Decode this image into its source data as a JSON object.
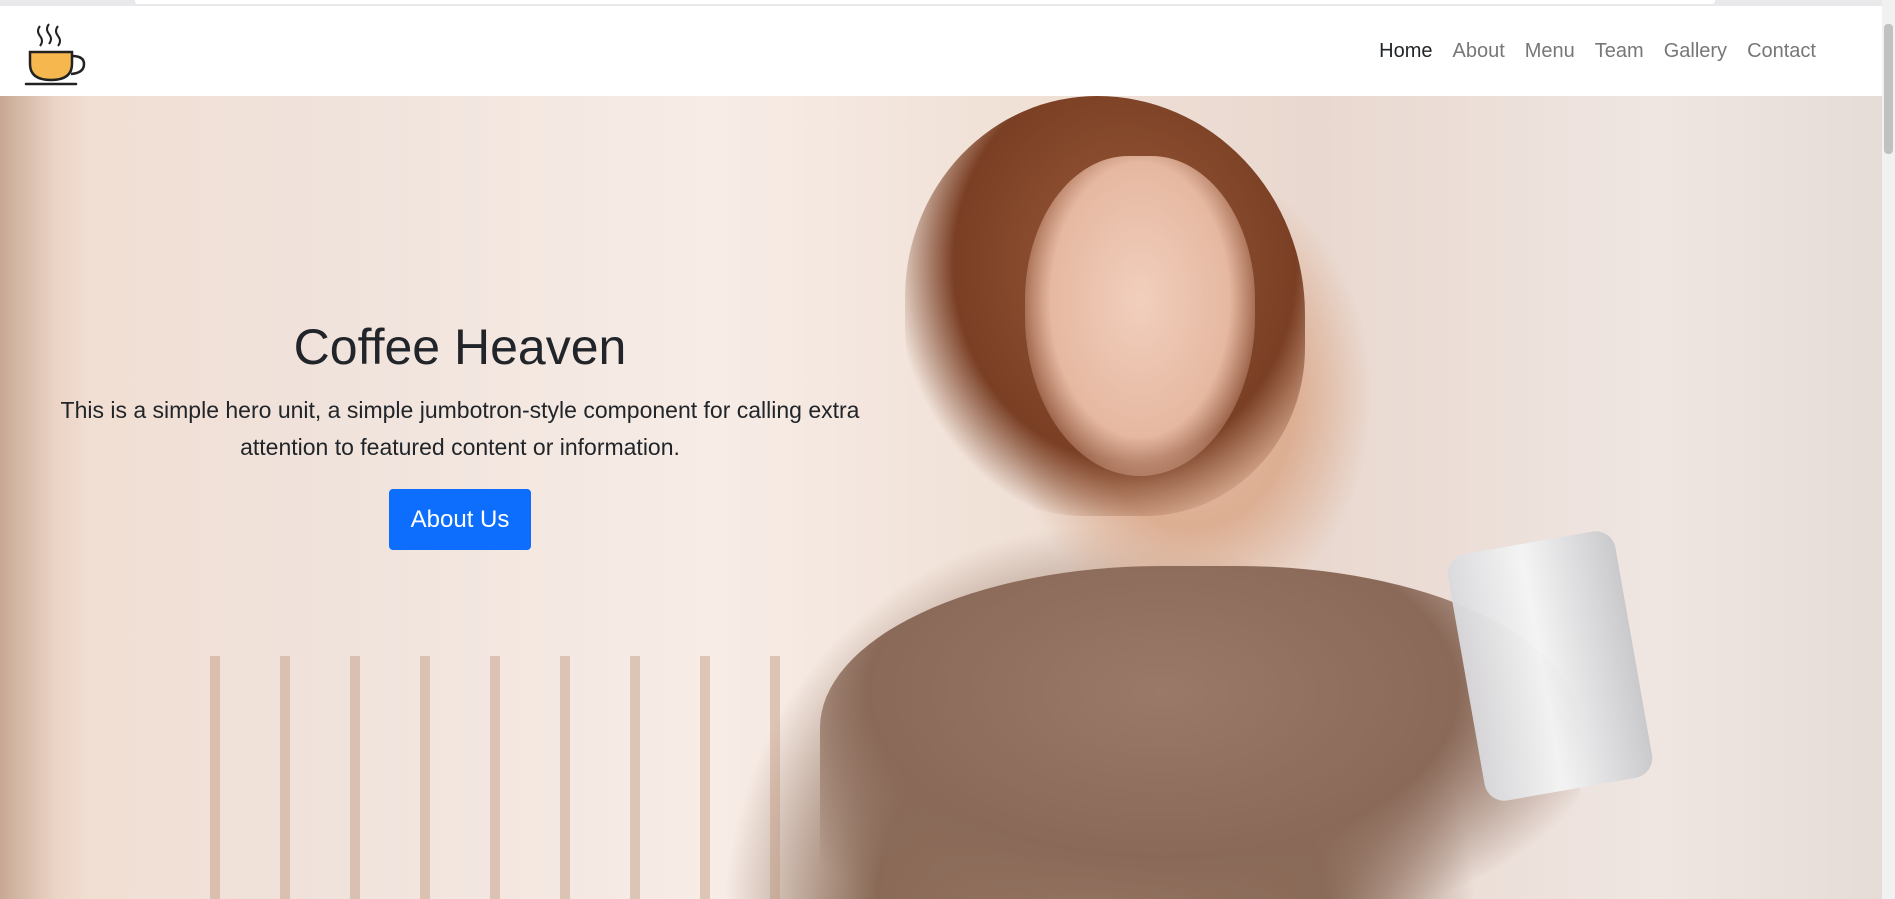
{
  "site": {
    "logo_icon": "coffee-cup-icon"
  },
  "nav": {
    "items": [
      {
        "label": "Home",
        "active": true
      },
      {
        "label": "About",
        "active": false
      },
      {
        "label": "Menu",
        "active": false
      },
      {
        "label": "Team",
        "active": false
      },
      {
        "label": "Gallery",
        "active": false
      },
      {
        "label": "Contact",
        "active": false
      }
    ]
  },
  "hero": {
    "title": "Coffee Heaven",
    "text": "This is a simple hero unit, a simple jumbotron-style component for calling extra attention to featured content or information.",
    "button_label": "About Us"
  },
  "colors": {
    "primary_button": "#0d6efd",
    "nav_active": "#212529",
    "nav_inactive": "#777777",
    "text_dark": "#212529"
  }
}
